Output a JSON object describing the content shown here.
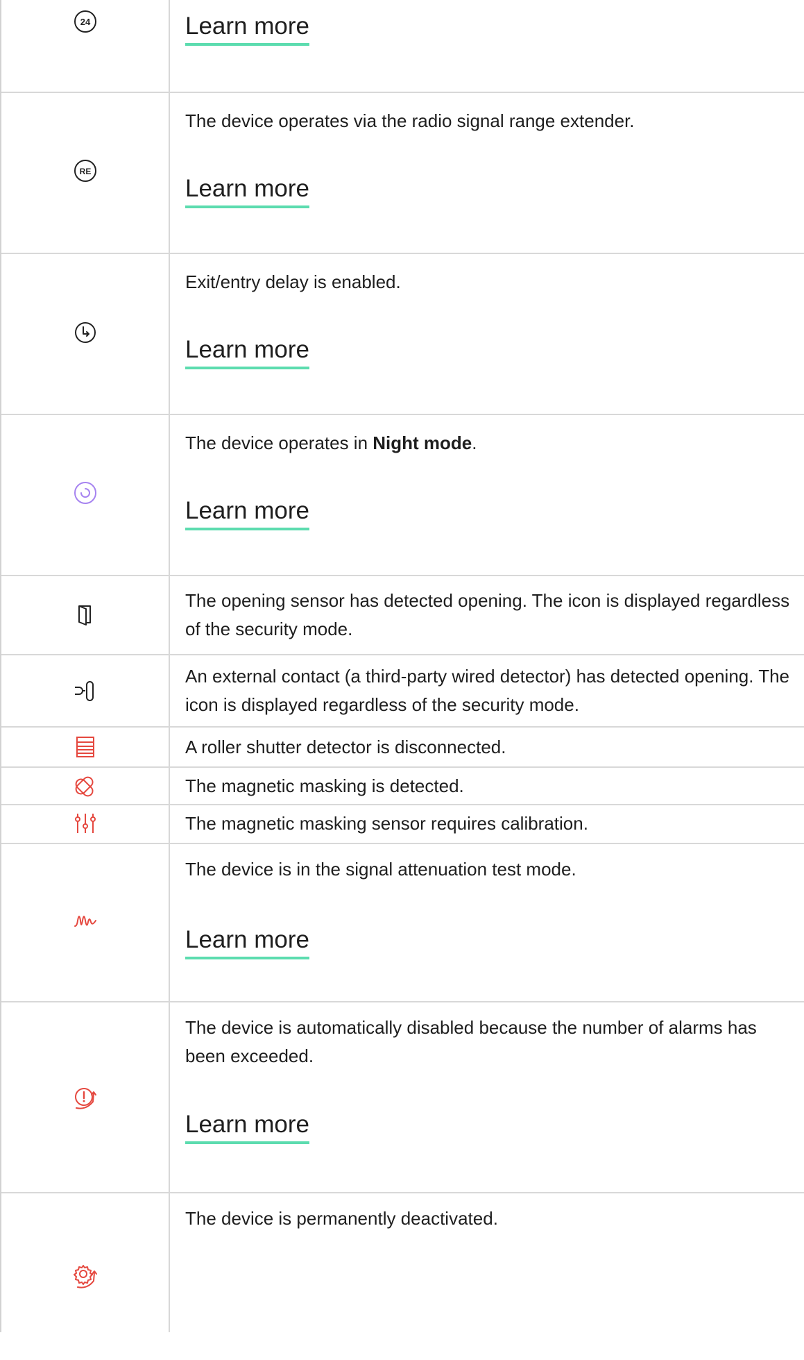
{
  "rows": [
    {
      "icon": "circled-24-icon",
      "description": null,
      "link": "Learn more"
    },
    {
      "icon": "circled-re-icon",
      "description": "The device operates via the radio signal range extender.",
      "link": "Learn more"
    },
    {
      "icon": "clock-arrow-icon",
      "description": "Exit/entry delay is enabled.",
      "link": "Learn more"
    },
    {
      "icon": "night-mode-icon",
      "description_pre": "The device operates in ",
      "description_bold": "Night mode",
      "description_post": ".",
      "link": "Learn more"
    },
    {
      "icon": "open-door-icon",
      "description": "The opening sensor has detected opening. The icon is displayed regardless of the security mode."
    },
    {
      "icon": "external-contact-icon",
      "description": "An external contact (a third-party wired detector) has detected opening. The icon is displayed regardless of the security mode."
    },
    {
      "icon": "roller-shutter-icon",
      "description": "A roller shutter detector is disconnected."
    },
    {
      "icon": "magnetic-masking-icon",
      "description": "The magnetic masking is detected."
    },
    {
      "icon": "calibration-sliders-icon",
      "description": "The magnetic masking sensor requires calibration."
    },
    {
      "icon": "signal-wave-icon",
      "description": "The device is in the signal attenuation test mode.",
      "link": "Learn more"
    },
    {
      "icon": "alarm-disabled-icon",
      "description": "The device is automatically disabled because the number of alarms has been exceeded.",
      "link": "Learn more"
    },
    {
      "icon": "gear-disabled-icon",
      "description": "The device is permanently deactivated."
    }
  ],
  "colors": {
    "text": "#1e1e1e",
    "link_underline": "#5cdcaf",
    "icon_dark": "#222222",
    "icon_red": "#e5483f",
    "icon_purple": "#a683f0",
    "border": "#d8d8d8"
  }
}
